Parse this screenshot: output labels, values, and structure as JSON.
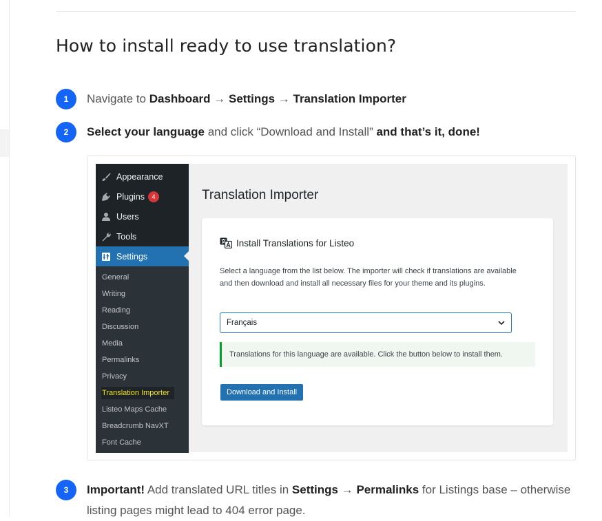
{
  "article": {
    "title": "How to install ready to use translation?",
    "steps": [
      {
        "num": "1",
        "parts": [
          {
            "t": "Navigate to "
          },
          {
            "t": "Dashboard",
            "b": true
          },
          {
            "t": " → "
          },
          {
            "t": "Settings",
            "b": true
          },
          {
            "t": " → "
          },
          {
            "t": "Translation Importer",
            "b": true
          }
        ]
      },
      {
        "num": "2",
        "parts": [
          {
            "t": "Select your language",
            "b": true
          },
          {
            "t": " and click “Download and Install” "
          },
          {
            "t": "and that’s it, done!",
            "b": true
          }
        ]
      },
      {
        "num": "3",
        "parts": [
          {
            "t": "Important!",
            "b": true
          },
          {
            "t": " Add translated URL titles in "
          },
          {
            "t": "Settings",
            "b": true
          },
          {
            "t": " → "
          },
          {
            "t": "Permalinks",
            "b": true
          },
          {
            "t": " for Listings base – otherwise listing pages might lead to 404 error page."
          }
        ]
      }
    ]
  },
  "wp": {
    "menu": [
      {
        "label": "Appearance",
        "icon": "paintbrush-icon"
      },
      {
        "label": "Plugins",
        "icon": "plugin-icon",
        "badge": "4"
      },
      {
        "label": "Users",
        "icon": "user-icon"
      },
      {
        "label": "Tools",
        "icon": "wrench-icon"
      },
      {
        "label": "Settings",
        "icon": "settings-icon",
        "active": true
      }
    ],
    "submenu": [
      "General",
      "Writing",
      "Reading",
      "Discussion",
      "Media",
      "Permalinks",
      "Privacy",
      "Translation Importer",
      "Listeo Maps Cache",
      "Breadcrumb NavXT",
      "Font Cache"
    ],
    "submenu_current": "Translation Importer",
    "page_title": "Translation Importer",
    "card": {
      "heading": "Install Translations for Listeo",
      "description": "Select a language from the list below. The importer will check if translations are available and then download and install all necessary files for your theme and its plugins.",
      "selected_language": "Français",
      "notice": "Translations for this language are available. Click the button below to install them.",
      "button_label": "Download and Install"
    }
  },
  "colors": {
    "step_badge": "#1464f6",
    "wp_sidebar": "#1d2327",
    "wp_accent": "#2271b1",
    "highlight": "#f2e216",
    "notice_border": "#00a32a"
  }
}
